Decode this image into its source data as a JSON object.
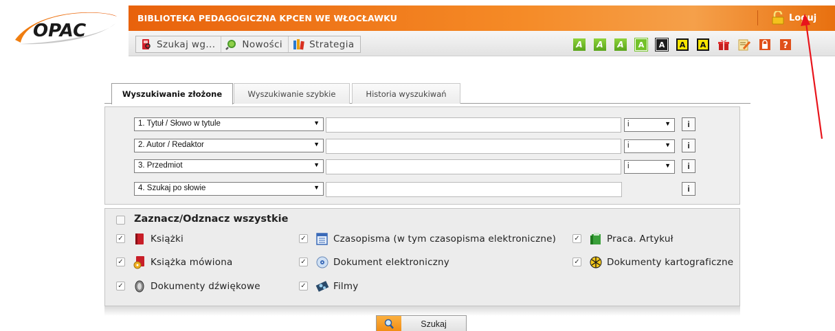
{
  "logo": {
    "text": "OPAC"
  },
  "header": {
    "library_title": "BIBLIOTEKA PEDAGOGICZNA KPCEN WE WŁOCŁAWKU",
    "login_label": "Loguj"
  },
  "menu": {
    "items": [
      {
        "label": "Szukaj wg...",
        "icon": "book-search-icon"
      },
      {
        "label": "Nowości",
        "icon": "magnifier-globe-icon"
      },
      {
        "label": "Strategia",
        "icon": "books-stack-icon"
      }
    ]
  },
  "tools": {
    "font_buttons": [
      "A",
      "A",
      "A",
      "A",
      "A",
      "A",
      "A"
    ],
    "icons": [
      "gift-icon",
      "edit-note-icon",
      "lock-icon",
      "help-icon"
    ]
  },
  "tabs": [
    {
      "label": "Wyszukiwanie złożone",
      "active": true
    },
    {
      "label": "Wyszukiwanie szybkie",
      "active": false
    },
    {
      "label": "Historia wyszukiwań",
      "active": false
    }
  ],
  "criteria": {
    "rows": [
      {
        "field": "1. Tytuł / Słowo w tytule",
        "value": "",
        "operator": "i"
      },
      {
        "field": "2. Autor / Redaktor",
        "value": "",
        "operator": "i"
      },
      {
        "field": "3. Przedmiot",
        "value": "",
        "operator": "i"
      },
      {
        "field": "4. Szukaj po słowie",
        "value": ""
      }
    ],
    "info_label": "i"
  },
  "types": {
    "toggle_all_label": "Zaznacz/Odznacz wszystkie",
    "toggle_all_checked": false,
    "items": [
      {
        "label": "Książki",
        "checked": true,
        "icon": "book-red-icon"
      },
      {
        "label": "Czasopisma (w tym czasopisma elektroniczne)",
        "checked": true,
        "icon": "calendar-magazine-icon"
      },
      {
        "label": "Praca. Artykuł",
        "checked": true,
        "icon": "green-binder-icon"
      },
      {
        "label": "Książka mówiona",
        "checked": true,
        "icon": "audiobook-icon"
      },
      {
        "label": "Dokument elektroniczny",
        "checked": true,
        "icon": "cd-disc-icon"
      },
      {
        "label": "Dokumenty kartograficzne",
        "checked": true,
        "icon": "globe-map-icon"
      },
      {
        "label": "Dokumenty dźwiękowe",
        "checked": true,
        "icon": "speaker-icon"
      },
      {
        "label": "Filmy",
        "checked": true,
        "icon": "film-reel-icon"
      }
    ]
  },
  "search_button": {
    "label": "Szukaj"
  },
  "colors": {
    "header_orange": "#e8620c",
    "annotation_red": "#e8141b"
  }
}
